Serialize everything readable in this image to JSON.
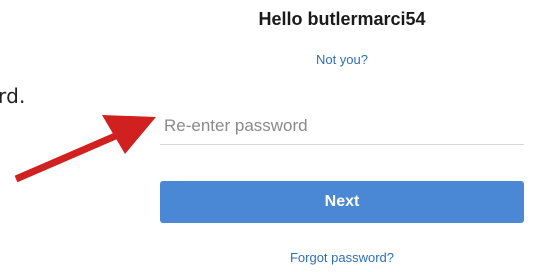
{
  "header": {
    "greeting": "Hello butlermarci54",
    "not_you_link": "Not you?"
  },
  "instruction": {
    "partial_text": "rd."
  },
  "form": {
    "password_placeholder": "Re-enter password",
    "password_value": "",
    "next_label": "Next",
    "forgot_link": "Forgot password?"
  },
  "annotation": {
    "arrow_color": "#d0201f",
    "arrow_icon": "red-arrow-icon"
  },
  "colors": {
    "button_bg": "#4a87d4",
    "link": "#2f6fb5"
  }
}
